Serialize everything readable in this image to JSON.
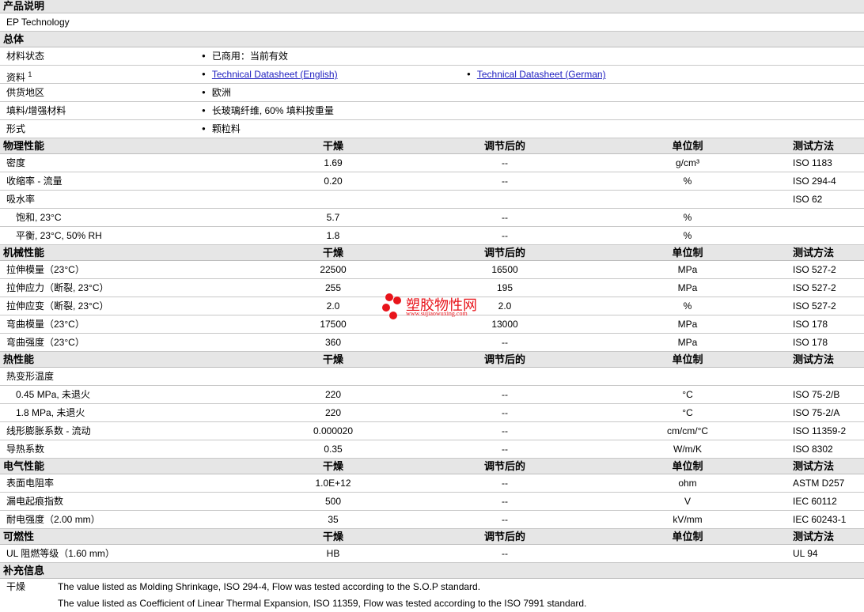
{
  "product": {
    "header": "产品说明",
    "name": "EP Technology"
  },
  "general": {
    "header": "总体",
    "rows": [
      {
        "label": "材料状态",
        "v": "已商用：当前有效"
      },
      {
        "label": "资料",
        "sup": "1",
        "link1": "Technical Datasheet (English)",
        "link2": "Technical Datasheet (German)"
      },
      {
        "label": "供货地区",
        "v": "欧洲"
      },
      {
        "label": "填料/增强材料",
        "v": "长玻璃纤维, 60% 填料按重量"
      },
      {
        "label": "形式",
        "v": "颗粒料"
      }
    ]
  },
  "cols": {
    "dry": "干燥",
    "cond": "调节后的",
    "unit": "单位制",
    "method": "测试方法"
  },
  "sections": [
    {
      "header": "物理性能",
      "rows": [
        {
          "label": "密度",
          "dry": "1.69",
          "cond": "--",
          "unit": "g/cm³",
          "method": "ISO 1183"
        },
        {
          "label": "收缩率  - 流量",
          "dry": "0.20",
          "cond": "--",
          "unit": "%",
          "method": "ISO 294-4"
        },
        {
          "label": "吸水率",
          "dry": "",
          "cond": "",
          "unit": "",
          "method": "ISO 62"
        },
        {
          "label": "饱和, 23°C",
          "sub": true,
          "dry": "5.7",
          "cond": "--",
          "unit": "%",
          "method": ""
        },
        {
          "label": "平衡, 23°C, 50% RH",
          "sub": true,
          "dry": "1.8",
          "cond": "--",
          "unit": "%",
          "method": ""
        }
      ]
    },
    {
      "header": "机械性能",
      "rows": [
        {
          "label": "拉伸模量（23°C）",
          "dry": "22500",
          "cond": "16500",
          "unit": "MPa",
          "method": "ISO 527-2"
        },
        {
          "label": "拉伸应力（断裂, 23°C）",
          "dry": "255",
          "cond": "195",
          "unit": "MPa",
          "method": "ISO 527-2"
        },
        {
          "label": "拉伸应变（断裂, 23°C）",
          "dry": "2.0",
          "cond": "2.0",
          "unit": "%",
          "method": "ISO 527-2"
        },
        {
          "label": "弯曲模量（23°C）",
          "dry": "17500",
          "cond": "13000",
          "unit": "MPa",
          "method": "ISO 178"
        },
        {
          "label": "弯曲强度（23°C）",
          "dry": "360",
          "cond": "--",
          "unit": "MPa",
          "method": "ISO 178"
        }
      ]
    },
    {
      "header": "热性能",
      "rows": [
        {
          "label": "热变形温度",
          "dry": "",
          "cond": "",
          "unit": "",
          "method": ""
        },
        {
          "label": "0.45 MPa, 未退火",
          "sub": true,
          "dry": "220",
          "cond": "--",
          "unit": "°C",
          "method": "ISO 75-2/B"
        },
        {
          "label": "1.8 MPa, 未退火",
          "sub": true,
          "dry": "220",
          "cond": "--",
          "unit": "°C",
          "method": "ISO 75-2/A"
        },
        {
          "label": "线形膨胀系数  - 流动",
          "dry": "0.000020",
          "cond": "--",
          "unit": "cm/cm/°C",
          "method": "ISO 11359-2"
        },
        {
          "label": "导热系数",
          "dry": "0.35",
          "cond": "--",
          "unit": "W/m/K",
          "method": "ISO 8302"
        }
      ]
    },
    {
      "header": "电气性能",
      "rows": [
        {
          "label": "表面电阻率",
          "dry": "1.0E+12",
          "cond": "--",
          "unit": "ohm",
          "method": "ASTM D257"
        },
        {
          "label": "漏电起痕指数",
          "dry": "500",
          "cond": "--",
          "unit": "V",
          "method": "IEC 60112"
        },
        {
          "label": "耐电强度（2.00 mm）",
          "dry": "35",
          "cond": "--",
          "unit": "kV/mm",
          "method": "IEC 60243-1"
        }
      ]
    },
    {
      "header": "可燃性",
      "rows": [
        {
          "label": "UL 阻燃等级（1.60 mm）",
          "dry": "HB",
          "cond": "--",
          "unit": "",
          "method": "UL 94"
        }
      ]
    }
  ],
  "supplement": {
    "header": "补充信息",
    "label": "干燥",
    "notes": [
      "The value listed as Molding Shrinkage, ISO 294-4, Flow was tested according to the S.O.P standard.",
      "The value listed as Coefficient of Linear Thermal Expansion, ISO 11359, Flow was tested according to the ISO 7991 standard."
    ]
  },
  "watermark": {
    "name": "塑胶物性网",
    "url": "www.sujiaowuxing.com"
  }
}
